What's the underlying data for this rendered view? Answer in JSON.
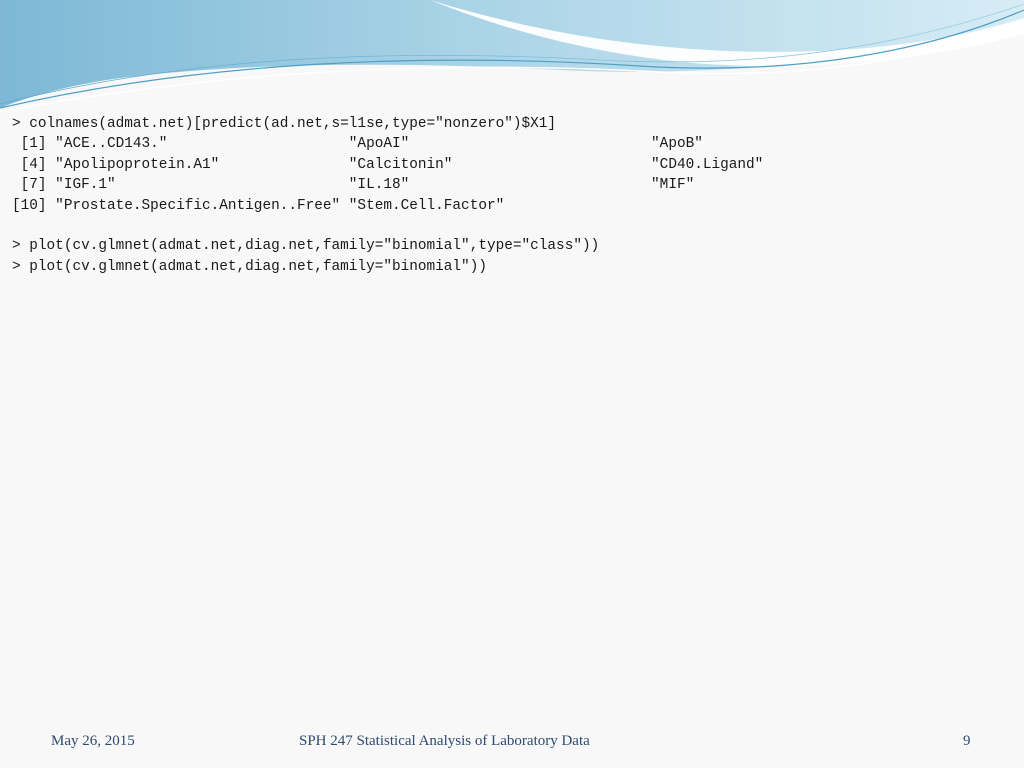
{
  "slide": {
    "code_lines": [
      "> colnames(admat.net)[predict(ad.net,s=l1se,type=\"nonzero\")$X1]",
      " [1] \"ACE..CD143.\"                     \"ApoAI\"                            \"ApoB\"",
      " [4] \"Apolipoprotein.A1\"               \"Calcitonin\"                       \"CD40.Ligand\"",
      " [7] \"IGF.1\"                           \"IL.18\"                            \"MIF\"",
      "[10] \"Prostate.Specific.Antigen..Free\" \"Stem.Cell.Factor\"",
      "",
      "> plot(cv.glmnet(admat.net,diag.net,family=\"binomial\",type=\"class\"))",
      "> plot(cv.glmnet(admat.net,diag.net,family=\"binomial\"))"
    ]
  },
  "footer": {
    "date": "May 26, 2015",
    "title": "SPH 247 Statistical Analysis of Laboratory Data",
    "page_number": "9"
  },
  "colors": {
    "background": "#f8f8f8",
    "header_wave_dark": "#7fbcd9",
    "header_wave_light": "#bfe0ef",
    "footer_text": "#2e4a6e"
  }
}
